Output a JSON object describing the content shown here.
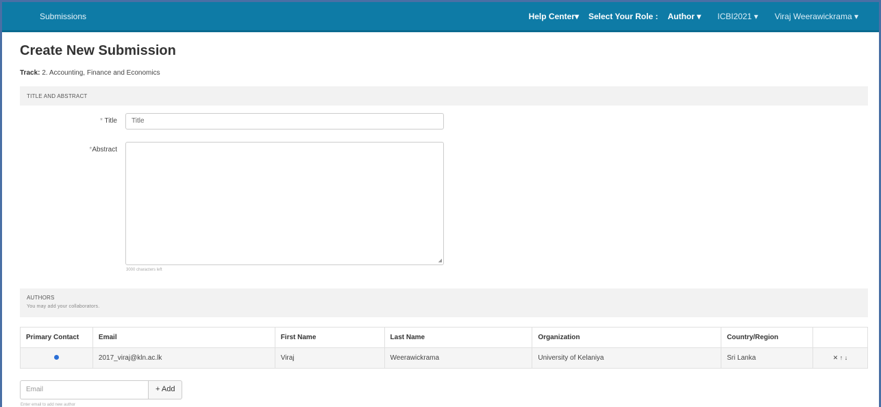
{
  "navbar": {
    "brand": "Submissions",
    "help_center": "Help Center",
    "select_role_label": "Select Your Role :",
    "role": "Author",
    "conference": "ICBI2021",
    "user": "Viraj Weerawickrama",
    "caret": "▾"
  },
  "page": {
    "title": "Create New Submission",
    "track_label": "Track:",
    "track_value": "2. Accounting, Finance and Economics"
  },
  "title_abstract": {
    "header": "TITLE AND ABSTRACT",
    "required_mark": "*",
    "title_label": "Title",
    "title_placeholder": "Title",
    "abstract_label": "Abstract",
    "counter": "3000 characters left"
  },
  "authors": {
    "header": "AUTHORS",
    "subtext": "You may add your collaborators.",
    "columns": [
      "Primary Contact",
      "Email",
      "First Name",
      "Last Name",
      "Organization",
      "Country/Region"
    ],
    "rows": [
      {
        "email": "2017_viraj@kln.ac.lk",
        "first_name": "Viraj",
        "last_name": "Weerawickrama",
        "organization": "University of Kelaniya",
        "country": "Sri Lanka"
      }
    ],
    "actions": "✕  ↑  ↓",
    "email_placeholder": "Email",
    "add_label": "+ Add",
    "hint": "Enter email to add new author"
  }
}
